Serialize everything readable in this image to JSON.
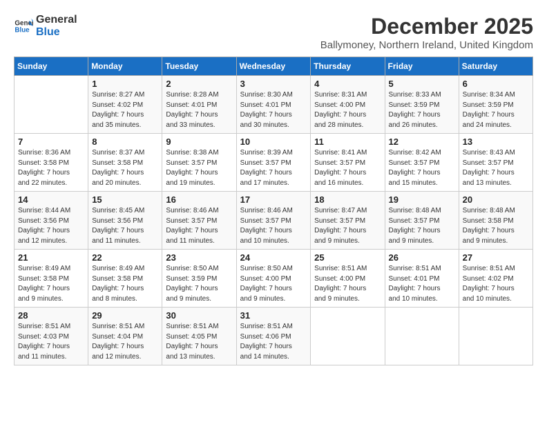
{
  "logo": {
    "line1": "General",
    "line2": "Blue"
  },
  "title": "December 2025",
  "subtitle": "Ballymoney, Northern Ireland, United Kingdom",
  "days_of_week": [
    "Sunday",
    "Monday",
    "Tuesday",
    "Wednesday",
    "Thursday",
    "Friday",
    "Saturday"
  ],
  "weeks": [
    [
      {
        "day": "",
        "info": ""
      },
      {
        "day": "1",
        "info": "Sunrise: 8:27 AM\nSunset: 4:02 PM\nDaylight: 7 hours\nand 35 minutes."
      },
      {
        "day": "2",
        "info": "Sunrise: 8:28 AM\nSunset: 4:01 PM\nDaylight: 7 hours\nand 33 minutes."
      },
      {
        "day": "3",
        "info": "Sunrise: 8:30 AM\nSunset: 4:01 PM\nDaylight: 7 hours\nand 30 minutes."
      },
      {
        "day": "4",
        "info": "Sunrise: 8:31 AM\nSunset: 4:00 PM\nDaylight: 7 hours\nand 28 minutes."
      },
      {
        "day": "5",
        "info": "Sunrise: 8:33 AM\nSunset: 3:59 PM\nDaylight: 7 hours\nand 26 minutes."
      },
      {
        "day": "6",
        "info": "Sunrise: 8:34 AM\nSunset: 3:59 PM\nDaylight: 7 hours\nand 24 minutes."
      }
    ],
    [
      {
        "day": "7",
        "info": "Sunrise: 8:36 AM\nSunset: 3:58 PM\nDaylight: 7 hours\nand 22 minutes."
      },
      {
        "day": "8",
        "info": "Sunrise: 8:37 AM\nSunset: 3:58 PM\nDaylight: 7 hours\nand 20 minutes."
      },
      {
        "day": "9",
        "info": "Sunrise: 8:38 AM\nSunset: 3:57 PM\nDaylight: 7 hours\nand 19 minutes."
      },
      {
        "day": "10",
        "info": "Sunrise: 8:39 AM\nSunset: 3:57 PM\nDaylight: 7 hours\nand 17 minutes."
      },
      {
        "day": "11",
        "info": "Sunrise: 8:41 AM\nSunset: 3:57 PM\nDaylight: 7 hours\nand 16 minutes."
      },
      {
        "day": "12",
        "info": "Sunrise: 8:42 AM\nSunset: 3:57 PM\nDaylight: 7 hours\nand 15 minutes."
      },
      {
        "day": "13",
        "info": "Sunrise: 8:43 AM\nSunset: 3:57 PM\nDaylight: 7 hours\nand 13 minutes."
      }
    ],
    [
      {
        "day": "14",
        "info": "Sunrise: 8:44 AM\nSunset: 3:56 PM\nDaylight: 7 hours\nand 12 minutes."
      },
      {
        "day": "15",
        "info": "Sunrise: 8:45 AM\nSunset: 3:56 PM\nDaylight: 7 hours\nand 11 minutes."
      },
      {
        "day": "16",
        "info": "Sunrise: 8:46 AM\nSunset: 3:57 PM\nDaylight: 7 hours\nand 11 minutes."
      },
      {
        "day": "17",
        "info": "Sunrise: 8:46 AM\nSunset: 3:57 PM\nDaylight: 7 hours\nand 10 minutes."
      },
      {
        "day": "18",
        "info": "Sunrise: 8:47 AM\nSunset: 3:57 PM\nDaylight: 7 hours\nand 9 minutes."
      },
      {
        "day": "19",
        "info": "Sunrise: 8:48 AM\nSunset: 3:57 PM\nDaylight: 7 hours\nand 9 minutes."
      },
      {
        "day": "20",
        "info": "Sunrise: 8:48 AM\nSunset: 3:58 PM\nDaylight: 7 hours\nand 9 minutes."
      }
    ],
    [
      {
        "day": "21",
        "info": "Sunrise: 8:49 AM\nSunset: 3:58 PM\nDaylight: 7 hours\nand 9 minutes."
      },
      {
        "day": "22",
        "info": "Sunrise: 8:49 AM\nSunset: 3:58 PM\nDaylight: 7 hours\nand 8 minutes."
      },
      {
        "day": "23",
        "info": "Sunrise: 8:50 AM\nSunset: 3:59 PM\nDaylight: 7 hours\nand 9 minutes."
      },
      {
        "day": "24",
        "info": "Sunrise: 8:50 AM\nSunset: 4:00 PM\nDaylight: 7 hours\nand 9 minutes."
      },
      {
        "day": "25",
        "info": "Sunrise: 8:51 AM\nSunset: 4:00 PM\nDaylight: 7 hours\nand 9 minutes."
      },
      {
        "day": "26",
        "info": "Sunrise: 8:51 AM\nSunset: 4:01 PM\nDaylight: 7 hours\nand 10 minutes."
      },
      {
        "day": "27",
        "info": "Sunrise: 8:51 AM\nSunset: 4:02 PM\nDaylight: 7 hours\nand 10 minutes."
      }
    ],
    [
      {
        "day": "28",
        "info": "Sunrise: 8:51 AM\nSunset: 4:03 PM\nDaylight: 7 hours\nand 11 minutes."
      },
      {
        "day": "29",
        "info": "Sunrise: 8:51 AM\nSunset: 4:04 PM\nDaylight: 7 hours\nand 12 minutes."
      },
      {
        "day": "30",
        "info": "Sunrise: 8:51 AM\nSunset: 4:05 PM\nDaylight: 7 hours\nand 13 minutes."
      },
      {
        "day": "31",
        "info": "Sunrise: 8:51 AM\nSunset: 4:06 PM\nDaylight: 7 hours\nand 14 minutes."
      },
      {
        "day": "",
        "info": ""
      },
      {
        "day": "",
        "info": ""
      },
      {
        "day": "",
        "info": ""
      }
    ]
  ]
}
